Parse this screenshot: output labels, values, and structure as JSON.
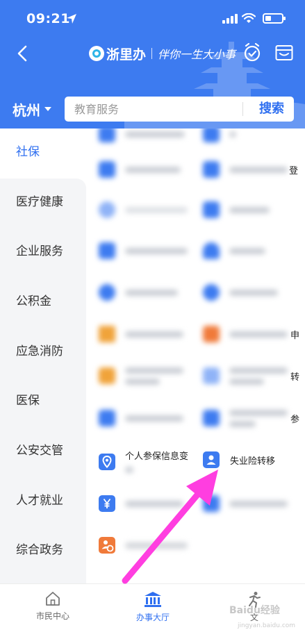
{
  "status_bar": {
    "time": "09:21"
  },
  "header": {
    "brand_name": "浙里办",
    "slogan": "伴你一生大小事",
    "city": "杭州",
    "search_placeholder": "教育服务",
    "search_button": "搜索",
    "accent_color": "#3d7bf0"
  },
  "categories": [
    {
      "label": "社保",
      "active": true
    },
    {
      "label": "医疗健康"
    },
    {
      "label": "企业服务"
    },
    {
      "label": "公积金"
    },
    {
      "label": "应急消防"
    },
    {
      "label": "医保"
    },
    {
      "label": "公安交管"
    },
    {
      "label": "人才就业"
    },
    {
      "label": "综合政务"
    }
  ],
  "services": {
    "top_right_partial": "登",
    "right_partial_1": "申",
    "right_partial_2": "转",
    "right_partial_3": "参",
    "insurance_info_change": "个人参保信息变",
    "unemployment_transfer": "失业险转移"
  },
  "tabbar": {
    "citizen_center": "市民中心",
    "service_hall": "办事大厅",
    "third_tab_partial": "文"
  },
  "watermark": {
    "main": "Baidu经验",
    "sub": "jingyan.baidu.com"
  },
  "annotation_color": "#ff3ee0"
}
